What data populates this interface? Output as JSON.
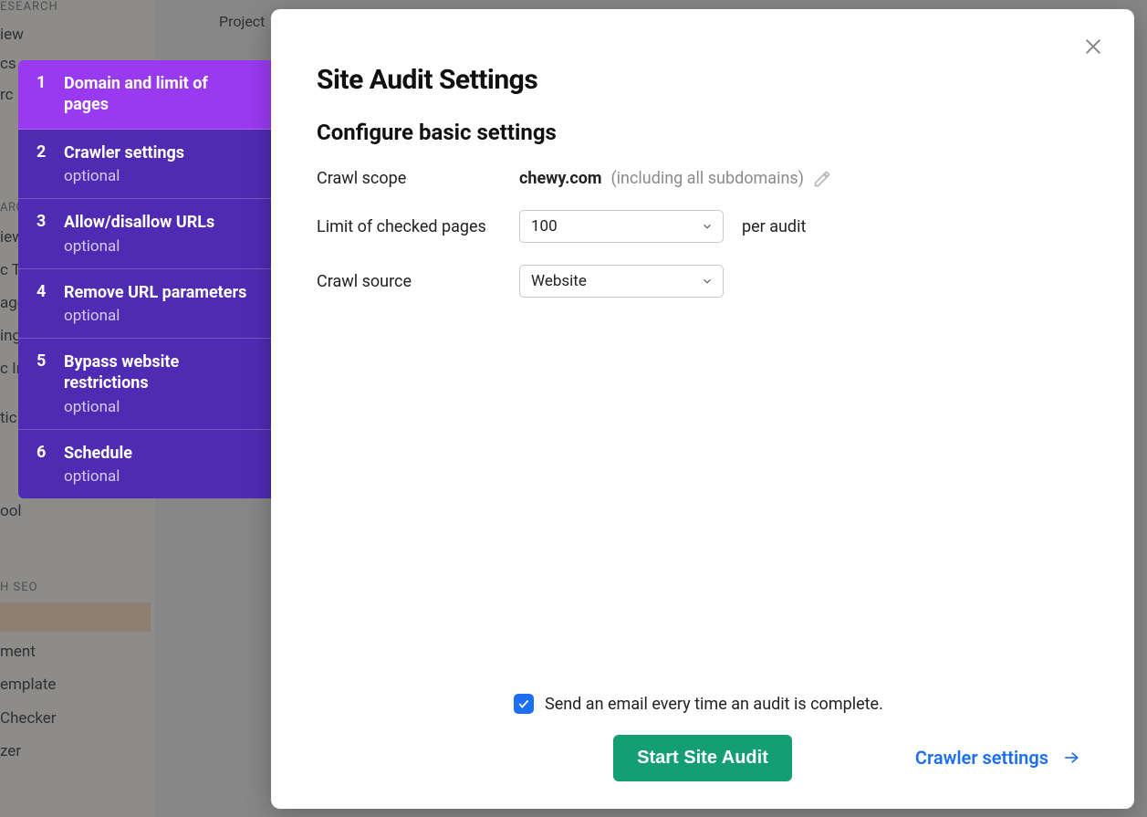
{
  "background": {
    "header_label": "Project",
    "sidebar_category_1": "ESEARCH",
    "sidebar_category_2": "H SEO",
    "sidebar_items_top": [
      "iew",
      "cs",
      "rc"
    ],
    "sidebar_items_mid": [
      "iew",
      "c T",
      "age",
      "ing",
      "c In",
      "tic",
      "ool"
    ],
    "sidebar_items_bot": [
      "ment",
      "emplate",
      "Checker",
      "zer"
    ]
  },
  "wizard_steps": [
    {
      "n": "1",
      "title": "Domain and limit of pages",
      "optional": false,
      "active": true
    },
    {
      "n": "2",
      "title": "Crawler settings",
      "optional": true,
      "active": false
    },
    {
      "n": "3",
      "title": "Allow/disallow URLs",
      "optional": true,
      "active": false
    },
    {
      "n": "4",
      "title": "Remove URL parameters",
      "optional": true,
      "active": false
    },
    {
      "n": "5",
      "title": "Bypass website restrictions",
      "optional": true,
      "active": false
    },
    {
      "n": "6",
      "title": "Schedule",
      "optional": true,
      "active": false
    }
  ],
  "optional_label": "optional",
  "modal": {
    "title": "Site Audit Settings",
    "section_title": "Configure basic settings",
    "crawl_scope": {
      "label": "Crawl scope",
      "domain": "chewy.com",
      "note": "(including all subdomains)"
    },
    "limit": {
      "label": "Limit of checked pages",
      "value": "100",
      "suffix": "per audit"
    },
    "source": {
      "label": "Crawl source",
      "value": "Website"
    },
    "email_checkbox": {
      "checked": true,
      "label": "Send an email every time an audit is complete."
    },
    "start_button": "Start Site Audit",
    "next_link": "Crawler settings"
  }
}
